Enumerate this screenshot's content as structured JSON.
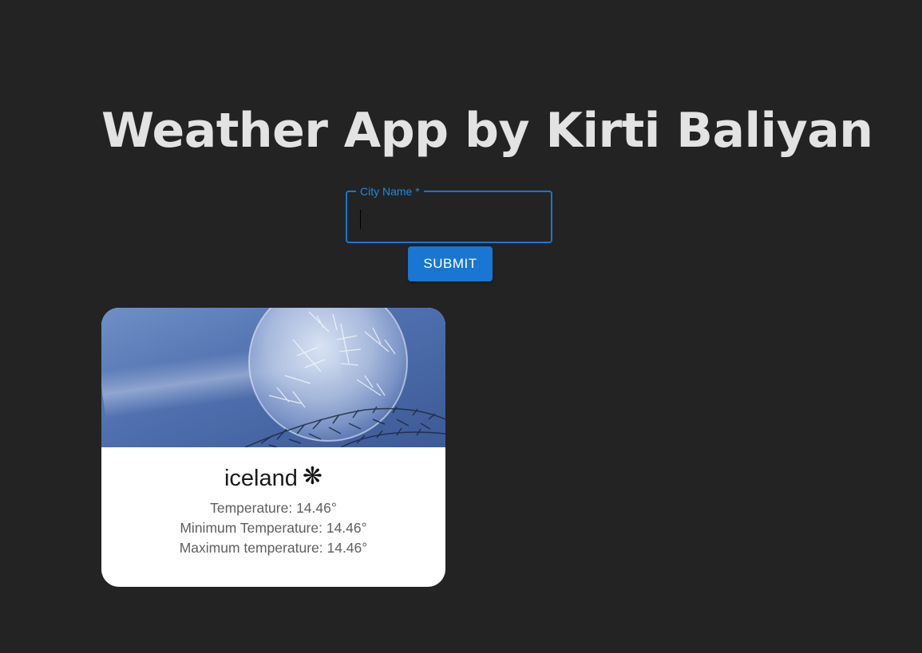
{
  "header": {
    "title": "Weather App by Kirti Baliyan"
  },
  "search": {
    "label": "City Name *",
    "value": "",
    "submit_label": "SUBMIT"
  },
  "card": {
    "city": "iceland",
    "icon": "snowflake-icon",
    "icon_glyph": "❋",
    "image": "frozen-soap-bubble-photo",
    "stats": [
      "Temperature: 14.46°",
      "Minimum Temperature: 14.46°",
      "Maximum temperature: 14.46°"
    ]
  },
  "colors": {
    "background": "#232323",
    "accent": "#1976d2",
    "title": "#e3e3e3",
    "card": "#ffffff"
  }
}
